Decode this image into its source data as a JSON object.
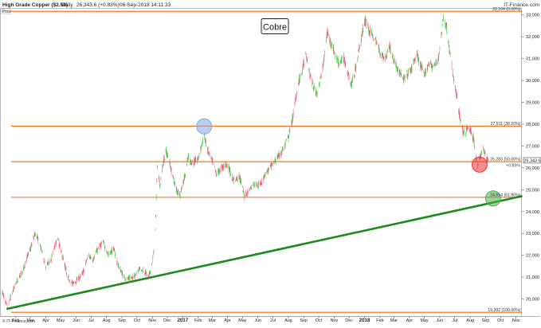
{
  "header": {
    "instrument": "High Grade Copper ($2.50)",
    "interval": "Daily",
    "quote": "26,343.6 (+0.83%)",
    "datetime": "06-Sep-2018 14:11:33",
    "price_label": "Price",
    "brand": "IT-Finance.com"
  },
  "footer_brand": "© IT-Finance.com",
  "chart_data": {
    "type": "candlestick",
    "title": "Cobre",
    "y_range": [
      19200,
      33300
    ],
    "y_ticks": [
      {
        "value": 20000,
        "label": "20,000"
      },
      {
        "value": 21000,
        "label": "21,000"
      },
      {
        "value": 22000,
        "label": "22,000"
      },
      {
        "value": 23000,
        "label": "23,000"
      },
      {
        "value": 24000,
        "label": "24,000"
      },
      {
        "value": 25000,
        "label": "25,000"
      },
      {
        "value": 26000,
        "label": "26,000"
      },
      {
        "value": 27000,
        "label": "27,000"
      },
      {
        "value": 28000,
        "label": "28,000"
      },
      {
        "value": 29000,
        "label": "29,000"
      },
      {
        "value": 30000,
        "label": "30,000"
      },
      {
        "value": 31000,
        "label": "31,000"
      },
      {
        "value": 32000,
        "label": "32,000"
      },
      {
        "value": 33000,
        "label": "33,000"
      }
    ],
    "x_range": [
      "2016-01-01",
      "2018-11-12"
    ],
    "x_ticks": [
      {
        "date": "2016-02-01",
        "label": "Feb",
        "bold": false
      },
      {
        "date": "2016-03-01",
        "label": "Mar",
        "bold": false
      },
      {
        "date": "2016-04-01",
        "label": "Apr",
        "bold": false
      },
      {
        "date": "2016-05-01",
        "label": "May",
        "bold": false
      },
      {
        "date": "2016-06-01",
        "label": "Jun",
        "bold": false
      },
      {
        "date": "2016-07-01",
        "label": "Jul",
        "bold": false
      },
      {
        "date": "2016-08-01",
        "label": "Aug",
        "bold": false
      },
      {
        "date": "2016-09-01",
        "label": "Sep",
        "bold": false
      },
      {
        "date": "2016-10-01",
        "label": "Oct",
        "bold": false
      },
      {
        "date": "2016-11-01",
        "label": "Nov",
        "bold": false
      },
      {
        "date": "2016-12-01",
        "label": "Dec",
        "bold": false
      },
      {
        "date": "2017-01-01",
        "label": "2017",
        "bold": true
      },
      {
        "date": "2017-02-01",
        "label": "Feb",
        "bold": false
      },
      {
        "date": "2017-03-01",
        "label": "Mar",
        "bold": false
      },
      {
        "date": "2017-04-01",
        "label": "Apr",
        "bold": false
      },
      {
        "date": "2017-05-01",
        "label": "May",
        "bold": false
      },
      {
        "date": "2017-06-01",
        "label": "Jun",
        "bold": false
      },
      {
        "date": "2017-07-01",
        "label": "Jul",
        "bold": false
      },
      {
        "date": "2017-08-01",
        "label": "Aug",
        "bold": false
      },
      {
        "date": "2017-09-01",
        "label": "Sep",
        "bold": false
      },
      {
        "date": "2017-10-01",
        "label": "Oct",
        "bold": false
      },
      {
        "date": "2017-11-01",
        "label": "Nov",
        "bold": false
      },
      {
        "date": "2017-12-01",
        "label": "Dec",
        "bold": false
      },
      {
        "date": "2018-01-01",
        "label": "2018",
        "bold": true
      },
      {
        "date": "2018-02-01",
        "label": "Feb",
        "bold": false
      },
      {
        "date": "2018-03-01",
        "label": "Mar",
        "bold": false
      },
      {
        "date": "2018-04-01",
        "label": "Apr",
        "bold": false
      },
      {
        "date": "2018-05-01",
        "label": "May",
        "bold": false
      },
      {
        "date": "2018-06-01",
        "label": "Jun",
        "bold": false
      },
      {
        "date": "2018-07-01",
        "label": "Jul",
        "bold": false
      },
      {
        "date": "2018-08-01",
        "label": "Aug",
        "bold": false
      },
      {
        "date": "2018-09-01",
        "label": "Sep",
        "bold": false
      },
      {
        "date": "2018-10-01",
        "label": "Oct",
        "bold": false
      },
      {
        "date": "2018-11-01",
        "label": "Nov",
        "bold": false
      }
    ],
    "price_path": [
      [
        "2016-01-05",
        20300
      ],
      [
        "2016-01-15",
        19600
      ],
      [
        "2016-01-22",
        20100
      ],
      [
        "2016-02-01",
        20700
      ],
      [
        "2016-02-15",
        21300
      ],
      [
        "2016-02-25",
        22000
      ],
      [
        "2016-03-03",
        22400
      ],
      [
        "2016-03-10",
        23000
      ],
      [
        "2016-03-17",
        22700
      ],
      [
        "2016-03-24",
        22200
      ],
      [
        "2016-04-01",
        21500
      ],
      [
        "2016-04-10",
        21700
      ],
      [
        "2016-04-18",
        22300
      ],
      [
        "2016-04-25",
        22800
      ],
      [
        "2016-05-03",
        22100
      ],
      [
        "2016-05-15",
        21000
      ],
      [
        "2016-05-25",
        20700
      ],
      [
        "2016-06-05",
        20900
      ],
      [
        "2016-06-15",
        21200
      ],
      [
        "2016-06-25",
        22000
      ],
      [
        "2016-07-05",
        21800
      ],
      [
        "2016-07-15",
        22300
      ],
      [
        "2016-07-25",
        22600
      ],
      [
        "2016-08-05",
        22000
      ],
      [
        "2016-08-15",
        22300
      ],
      [
        "2016-08-25",
        21500
      ],
      [
        "2016-09-05",
        21000
      ],
      [
        "2016-09-15",
        20900
      ],
      [
        "2016-09-25",
        21000
      ],
      [
        "2016-10-05",
        21400
      ],
      [
        "2016-10-15",
        21300
      ],
      [
        "2016-10-25",
        21000
      ],
      [
        "2016-11-01",
        21700
      ],
      [
        "2016-11-05",
        22300
      ],
      [
        "2016-11-08",
        23800
      ],
      [
        "2016-11-11",
        26100
      ],
      [
        "2016-11-16",
        25200
      ],
      [
        "2016-11-22",
        26100
      ],
      [
        "2016-11-28",
        26800
      ],
      [
        "2016-12-05",
        26300
      ],
      [
        "2016-12-12",
        25600
      ],
      [
        "2016-12-19",
        25000
      ],
      [
        "2016-12-27",
        24800
      ],
      [
        "2017-01-05",
        25600
      ],
      [
        "2017-01-12",
        26500
      ],
      [
        "2017-01-20",
        26200
      ],
      [
        "2017-02-01",
        26400
      ],
      [
        "2017-02-13",
        27500
      ],
      [
        "2017-02-20",
        26800
      ],
      [
        "2017-03-01",
        26300
      ],
      [
        "2017-03-10",
        25700
      ],
      [
        "2017-03-20",
        26000
      ],
      [
        "2017-04-01",
        26200
      ],
      [
        "2017-04-12",
        25400
      ],
      [
        "2017-04-25",
        25600
      ],
      [
        "2017-05-05",
        24700
      ],
      [
        "2017-05-15",
        25000
      ],
      [
        "2017-05-25",
        25300
      ],
      [
        "2017-06-05",
        25200
      ],
      [
        "2017-06-15",
        25700
      ],
      [
        "2017-06-25",
        26000
      ],
      [
        "2017-07-05",
        26300
      ],
      [
        "2017-07-15",
        26600
      ],
      [
        "2017-07-25",
        27000
      ],
      [
        "2017-08-01",
        27400
      ],
      [
        "2017-08-10",
        28300
      ],
      [
        "2017-08-20",
        29800
      ],
      [
        "2017-08-28",
        30400
      ],
      [
        "2017-09-05",
        31200
      ],
      [
        "2017-09-12",
        30400
      ],
      [
        "2017-09-20",
        29700
      ],
      [
        "2017-09-28",
        29400
      ],
      [
        "2017-10-05",
        30100
      ],
      [
        "2017-10-12",
        31000
      ],
      [
        "2017-10-18",
        32200
      ],
      [
        "2017-10-25",
        31800
      ],
      [
        "2017-11-01",
        31300
      ],
      [
        "2017-11-10",
        30800
      ],
      [
        "2017-11-20",
        31000
      ],
      [
        "2017-11-28",
        30400
      ],
      [
        "2017-12-05",
        29800
      ],
      [
        "2017-12-12",
        30300
      ],
      [
        "2017-12-20",
        31300
      ],
      [
        "2017-12-28",
        32200
      ],
      [
        "2018-01-03",
        32800
      ],
      [
        "2018-01-10",
        32300
      ],
      [
        "2018-01-18",
        32000
      ],
      [
        "2018-01-26",
        31700
      ],
      [
        "2018-02-02",
        31200
      ],
      [
        "2018-02-12",
        31000
      ],
      [
        "2018-02-20",
        31600
      ],
      [
        "2018-03-01",
        30900
      ],
      [
        "2018-03-10",
        30500
      ],
      [
        "2018-03-20",
        30000
      ],
      [
        "2018-03-28",
        30300
      ],
      [
        "2018-04-05",
        30500
      ],
      [
        "2018-04-15",
        31200
      ],
      [
        "2018-04-22",
        30800
      ],
      [
        "2018-05-01",
        30200
      ],
      [
        "2018-05-10",
        30800
      ],
      [
        "2018-05-20",
        30600
      ],
      [
        "2018-05-28",
        30900
      ],
      [
        "2018-06-04",
        32000
      ],
      [
        "2018-06-08",
        32900
      ],
      [
        "2018-06-14",
        32500
      ],
      [
        "2018-06-20",
        31500
      ],
      [
        "2018-06-27",
        30300
      ],
      [
        "2018-07-05",
        29300
      ],
      [
        "2018-07-12",
        28200
      ],
      [
        "2018-07-19",
        27500
      ],
      [
        "2018-07-26",
        27800
      ],
      [
        "2018-08-02",
        27700
      ],
      [
        "2018-08-09",
        27200
      ],
      [
        "2018-08-15",
        26100
      ],
      [
        "2018-08-20",
        26400
      ],
      [
        "2018-08-27",
        26900
      ],
      [
        "2018-09-03",
        26400
      ],
      [
        "2018-09-06",
        26344
      ]
    ],
    "horizontal_levels": [
      {
        "value": 33164,
        "label": "33,164 (0.00%)"
      },
      {
        "value": 27911,
        "label": "27,911 (38.20%)"
      },
      {
        "value": 26283,
        "label": "26,283 (50.00%)"
      },
      {
        "value": 24654,
        "label": "24,654 (61.80%)"
      },
      {
        "value": 19392,
        "label": "19,392 (100.00%)"
      }
    ],
    "last_price_label": "26,343.6",
    "change_label": "+0.83%",
    "trendline": {
      "from": [
        "2016-01-15",
        19550
      ],
      "to": [
        "2018-11-12",
        24700
      ]
    },
    "highlights": [
      {
        "date": "2017-02-13",
        "value": 27900,
        "color": "#7da7e8"
      },
      {
        "date": "2018-08-20",
        "value": 26150,
        "color": "#ee3333"
      },
      {
        "date": "2018-09-16",
        "value": 24600,
        "color": "#4caf50"
      }
    ],
    "colors": {
      "up": "#46c646",
      "down": "#e85a7a",
      "level": "#ff7722",
      "trend": "#1a8a1a"
    }
  }
}
